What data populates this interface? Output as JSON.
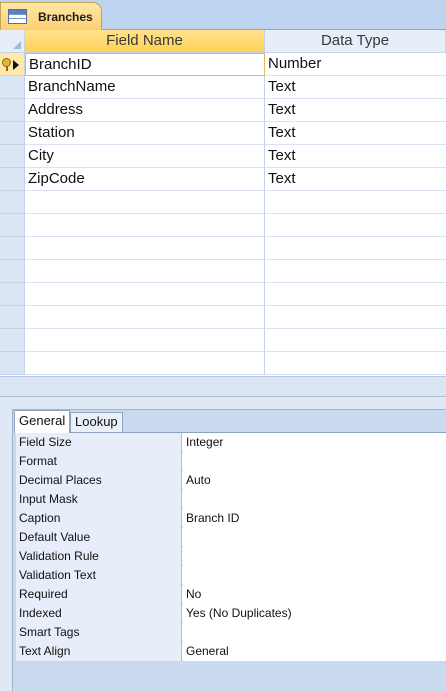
{
  "window": {
    "tab_title": "Branches",
    "tab_icon": "table-icon"
  },
  "grid": {
    "columns": [
      "Field Name",
      "Data Type"
    ],
    "rows": [
      {
        "field": "BranchID",
        "type": "Number",
        "primary_key": true
      },
      {
        "field": "BranchName",
        "type": "Text"
      },
      {
        "field": "Address",
        "type": "Text"
      },
      {
        "field": "Station",
        "type": "Text"
      },
      {
        "field": "City",
        "type": "Text"
      },
      {
        "field": "ZipCode",
        "type": "Text"
      },
      {
        "field": "",
        "type": ""
      },
      {
        "field": "",
        "type": ""
      },
      {
        "field": "",
        "type": ""
      },
      {
        "field": "",
        "type": ""
      },
      {
        "field": "",
        "type": ""
      },
      {
        "field": "",
        "type": ""
      },
      {
        "field": "",
        "type": ""
      },
      {
        "field": "",
        "type": ""
      }
    ]
  },
  "properties": {
    "tabs": [
      "General",
      "Lookup"
    ],
    "active_tab": "General",
    "rows": [
      {
        "label": "Field Size",
        "value": "Integer"
      },
      {
        "label": "Format",
        "value": ""
      },
      {
        "label": "Decimal Places",
        "value": "Auto"
      },
      {
        "label": "Input Mask",
        "value": ""
      },
      {
        "label": "Caption",
        "value": "Branch ID"
      },
      {
        "label": "Default Value",
        "value": ""
      },
      {
        "label": "Validation Rule",
        "value": ""
      },
      {
        "label": "Validation Text",
        "value": ""
      },
      {
        "label": "Required",
        "value": "No"
      },
      {
        "label": "Indexed",
        "value": "Yes (No Duplicates)"
      },
      {
        "label": "Smart Tags",
        "value": ""
      },
      {
        "label": "Text Align",
        "value": "General"
      }
    ]
  },
  "colors": {
    "header_highlight": "#ffd255",
    "grid_line": "#c3d2e6",
    "background": "#dbe6f4"
  }
}
